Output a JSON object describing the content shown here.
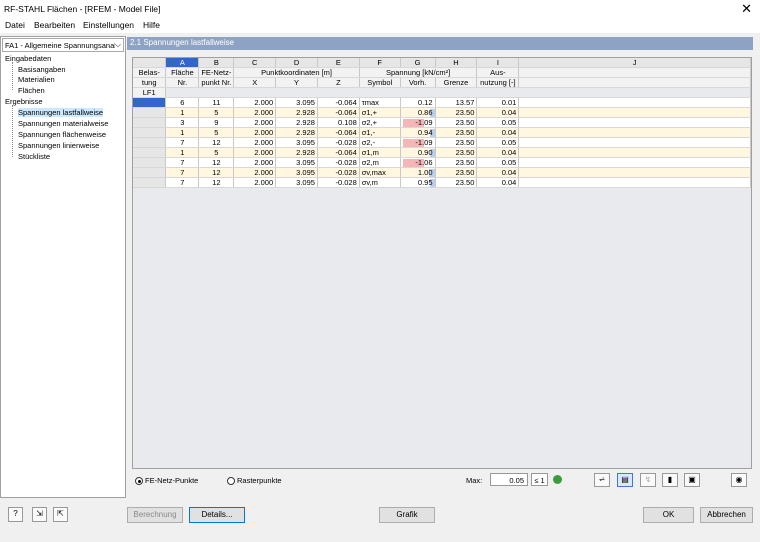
{
  "window": {
    "title": "RF-STAHL Flächen - [RFEM - Model File]",
    "close_glyph": "✕"
  },
  "menu": [
    "Datei",
    "Bearbeiten",
    "Einstellungen",
    "Hilfe"
  ],
  "case_select": {
    "value": "FA1 - Allgemeine Spannungsanalyse"
  },
  "tree": {
    "input_group": "Eingabedaten",
    "input_items": [
      "Basisangaben",
      "Materialien",
      "Flächen"
    ],
    "results_group": "Ergebnisse",
    "results_items": [
      "Spannungen lastfallweise",
      "Spannungen materialweise",
      "Spannungen flächenweise",
      "Spannungen linienweise",
      "Stückliste"
    ]
  },
  "section_title": "2.1 Spannungen lastfallweise",
  "grid": {
    "letters": [
      "A",
      "B",
      "C",
      "D",
      "E",
      "F",
      "G",
      "H",
      "I",
      "J"
    ],
    "hdr": {
      "belastung1": "Belas-",
      "belastung2": "tung",
      "flaeche1": "Fläche",
      "flaeche2": "Nr.",
      "fenetz1": "FE-Netz-",
      "fenetz2": "punkt Nr.",
      "punkt": "Punktkoordinaten [m]",
      "x": "X",
      "y": "Y",
      "z": "Z",
      "spannung": "Spannung [kN/cm²]",
      "symbol": "Symbol",
      "vorh": "Vorh.",
      "grenze": "Grenze",
      "aus1": "Aus-",
      "aus2": "nutzung [-]"
    },
    "load_case": "LF1",
    "rows": [
      {
        "flaeche": "6",
        "fenetz": "11",
        "x": "2.000",
        "y": "3.095",
        "z": "-0.064",
        "symbol": "τmax",
        "vorh": "0.12",
        "grenze": "13.57",
        "ausnutzung": "0.01"
      },
      {
        "flaeche": "1",
        "fenetz": "5",
        "x": "2.000",
        "y": "2.928",
        "z": "-0.064",
        "symbol": "σ1,+",
        "vorh": "0.86",
        "grenze": "23.50",
        "ausnutzung": "0.04"
      },
      {
        "flaeche": "3",
        "fenetz": "9",
        "x": "2.000",
        "y": "2.928",
        "z": "0.108",
        "symbol": "σ2,+",
        "vorh": "-1.09",
        "grenze": "23.50",
        "ausnutzung": "0.05"
      },
      {
        "flaeche": "1",
        "fenetz": "5",
        "x": "2.000",
        "y": "2.928",
        "z": "-0.064",
        "symbol": "σ1,-",
        "vorh": "0.94",
        "grenze": "23.50",
        "ausnutzung": "0.04"
      },
      {
        "flaeche": "7",
        "fenetz": "12",
        "x": "2.000",
        "y": "3.095",
        "z": "-0.028",
        "symbol": "σ2,-",
        "vorh": "-1.09",
        "grenze": "23.50",
        "ausnutzung": "0.05"
      },
      {
        "flaeche": "1",
        "fenetz": "5",
        "x": "2.000",
        "y": "2.928",
        "z": "-0.064",
        "symbol": "σ1,m",
        "vorh": "0.90",
        "grenze": "23.50",
        "ausnutzung": "0.04"
      },
      {
        "flaeche": "7",
        "fenetz": "12",
        "x": "2.000",
        "y": "3.095",
        "z": "-0.028",
        "symbol": "σ2,m",
        "vorh": "-1.06",
        "grenze": "23.50",
        "ausnutzung": "0.05"
      },
      {
        "flaeche": "7",
        "fenetz": "12",
        "x": "2.000",
        "y": "3.095",
        "z": "-0.028",
        "symbol": "σv,max",
        "vorh": "1.00",
        "grenze": "23.50",
        "ausnutzung": "0.04"
      },
      {
        "flaeche": "7",
        "fenetz": "12",
        "x": "2.000",
        "y": "3.095",
        "z": "-0.028",
        "symbol": "σv,m",
        "vorh": "0.95",
        "grenze": "23.50",
        "ausnutzung": "0.04"
      }
    ],
    "colors": {
      "pos": "#b9cff0",
      "neg": "#f4b6b6",
      "active": "#2f68c8",
      "header": "#8ea3c3"
    }
  },
  "options": {
    "radio1": "FE-Netz-Punkte",
    "radio2": "Rasterpunkte",
    "max_label": "Max:",
    "max_value": "0.05",
    "limit": "≤ 1"
  },
  "buttons": {
    "berechnung": "Berechnung",
    "details": "Details...",
    "grafik": "Grafik",
    "ok": "OK",
    "abbrechen": "Abbrechen"
  }
}
